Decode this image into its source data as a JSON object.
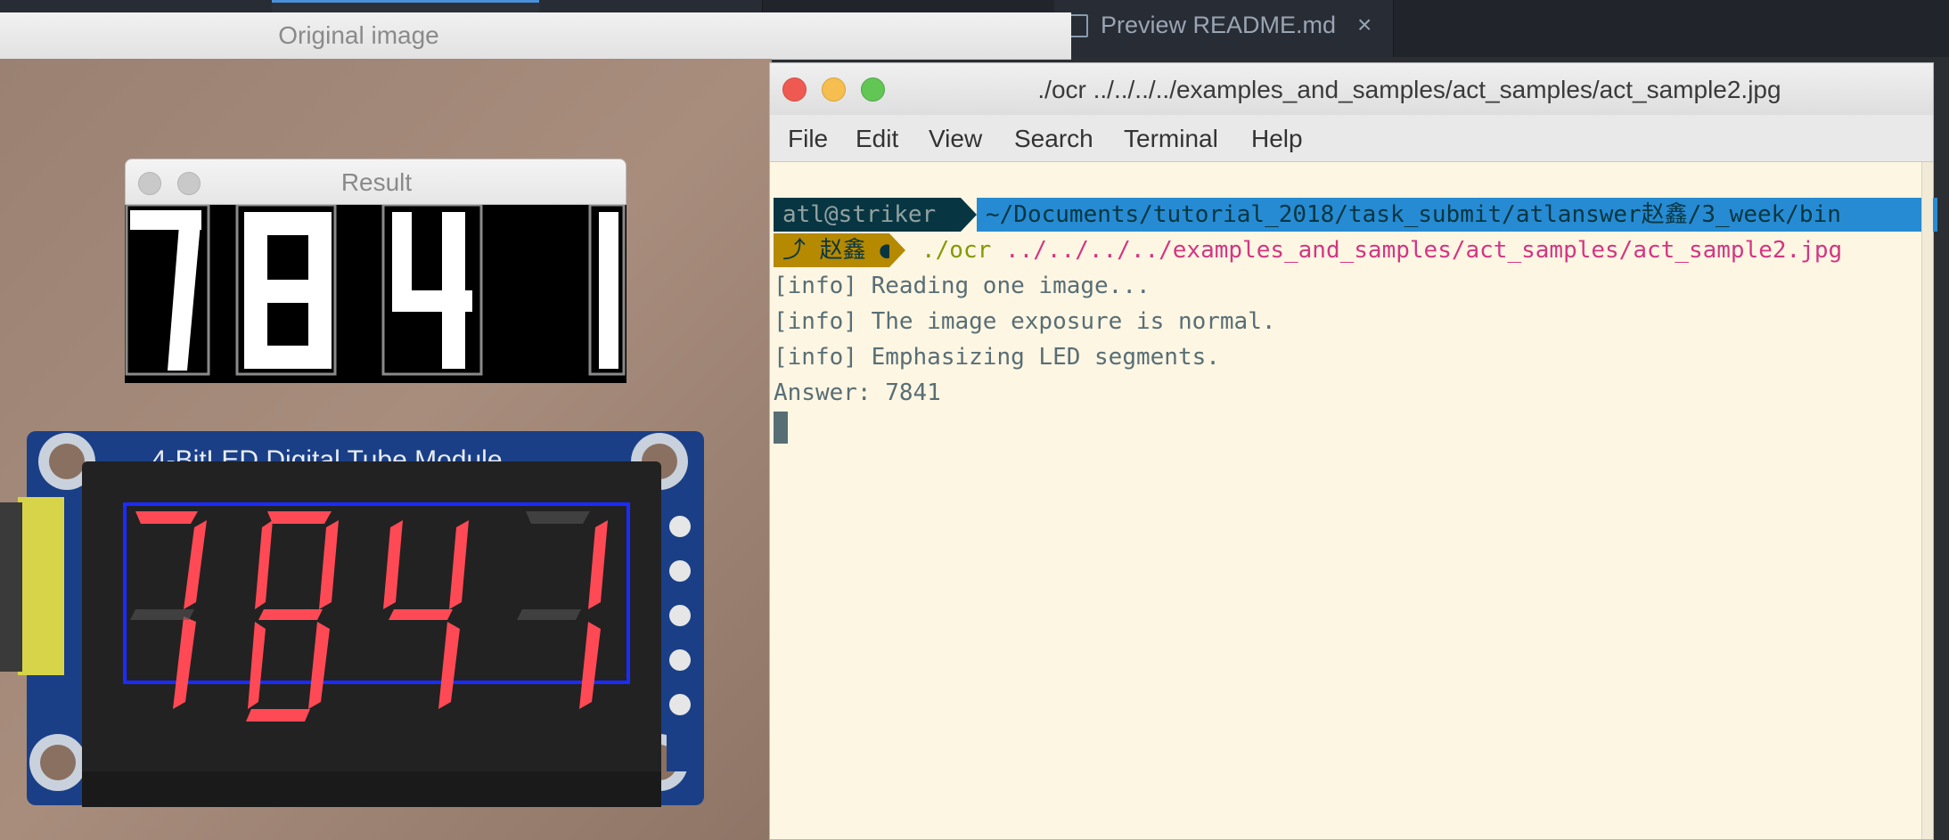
{
  "editor": {
    "tab_label": "Preview README.md",
    "tab_close": "×"
  },
  "original_window": {
    "title": "Original image",
    "photo_module_label": "4-BitLED Digital Tube Module",
    "photo_digits": "7841"
  },
  "result_window": {
    "title": "Result",
    "digits": [
      "7",
      "8",
      "4",
      "1"
    ]
  },
  "terminal": {
    "title": "./ocr ../../../../examples_and_samples/act_samples/act_sample2.jpg",
    "menu": [
      "File",
      "Edit",
      "View",
      "Search",
      "Terminal",
      "Help"
    ],
    "prompt_user": "atl@striker",
    "prompt_path": "~/Documents/tutorial_2018/task_submit/atlanswer赵鑫/3_week/bin",
    "prompt_branch": "⤴ 赵鑫 ●",
    "cmd_program": "./ocr",
    "cmd_args": "../../../../examples_and_samples/act_samples/act_sample2.jpg",
    "output": [
      "[info] Reading one image...",
      "[info] The image exposure is normal.",
      "[info] Emphasizing LED segments.",
      "Answer: 7841"
    ]
  },
  "colors": {
    "terminal_bg": "#fdf6e3",
    "prompt_user_bg": "#073642",
    "prompt_path_bg": "#268bd2",
    "prompt_branch_bg": "#b58900",
    "cmd_green": "#859900",
    "cmd_magenta": "#d33682",
    "led_red": "#ff4a55",
    "pcb_blue": "#1a3f86"
  }
}
